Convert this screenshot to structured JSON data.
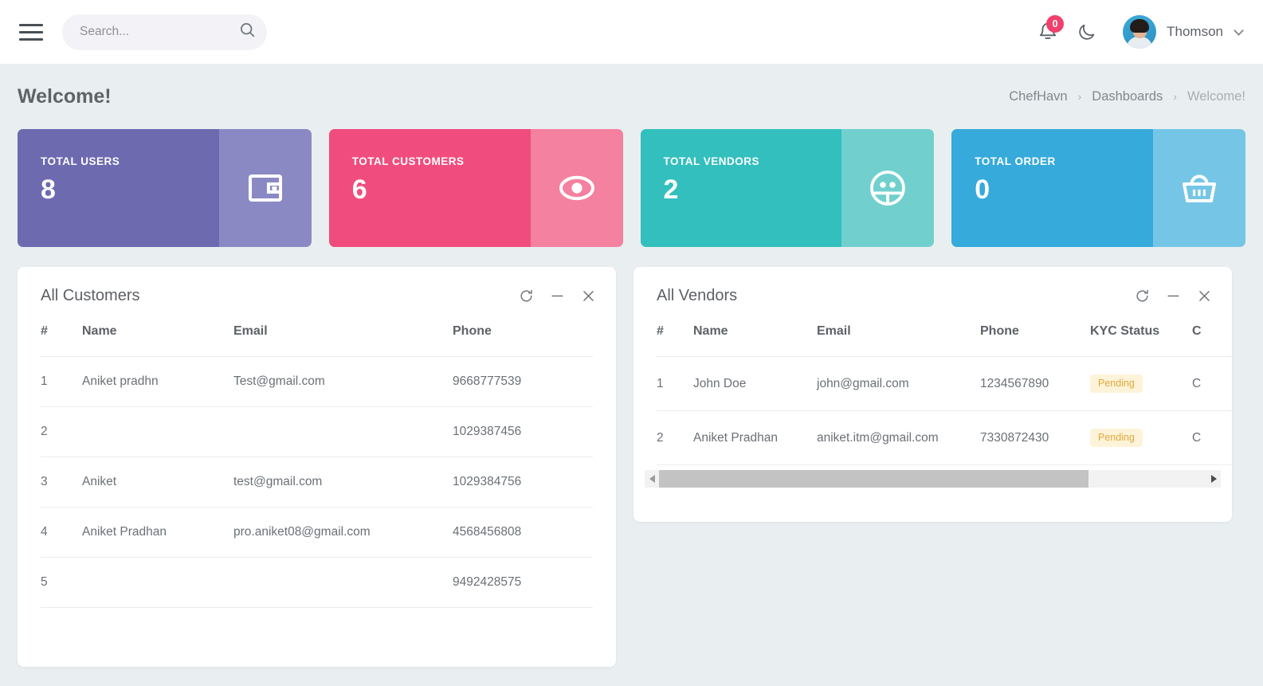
{
  "topbar": {
    "menu_icon": "hamburger-icon",
    "search": {
      "placeholder": "Search...",
      "value": "",
      "icon": "search-icon"
    },
    "notifications": {
      "count": "0",
      "icon": "bell-icon"
    },
    "theme_toggle": {
      "icon": "moon-icon"
    },
    "user": {
      "name": "Thomson",
      "avatar": "user-avatar",
      "chevron": "chevron-down-icon"
    }
  },
  "page": {
    "title": "Welcome!",
    "breadcrumb": [
      {
        "label": "ChefHavn",
        "active": false
      },
      {
        "label": "Dashboards",
        "active": false
      },
      {
        "label": "Welcome!",
        "active": true
      }
    ],
    "breadcrumb_separator": "›"
  },
  "stats": [
    {
      "label": "TOTAL USERS",
      "value": "8",
      "icon": "wallet-icon",
      "color": "#6d6ab0",
      "icon_bg": "#8b89c4"
    },
    {
      "label": "TOTAL CUSTOMERS",
      "value": "6",
      "icon": "eye-icon",
      "color": "#f1traverse",
      "bg": "#f04d7e",
      "icon_bg": "#f4819f"
    },
    {
      "label": "TOTAL VENDORS",
      "value": "2",
      "icon": "people-icon",
      "bg": "#33bfbd",
      "icon_bg": "#71d0ce"
    },
    {
      "label": "TOTAL ORDER",
      "value": "0",
      "icon": "basket-icon",
      "bg": "#36aada",
      "icon_bg": "#75c6e6"
    }
  ],
  "customers_panel": {
    "title": "All Customers",
    "tools": [
      "refresh-icon",
      "minimize-icon",
      "close-icon"
    ],
    "columns": [
      "#",
      "Name",
      "Email",
      "Phone"
    ],
    "rows": [
      {
        "idx": "1",
        "name": "Aniket pradhn",
        "email": "Test@gmail.com",
        "phone": "9668777539"
      },
      {
        "idx": "2",
        "name": "",
        "email": "",
        "phone": "1029387456"
      },
      {
        "idx": "3",
        "name": "Aniket",
        "email": "test@gmail.com",
        "phone": "1029384756"
      },
      {
        "idx": "4",
        "name": "Aniket Pradhan",
        "email": "pro.aniket08@gmail.com",
        "phone": "4568456808"
      },
      {
        "idx": "5",
        "name": "",
        "email": "",
        "phone": "9492428575"
      }
    ]
  },
  "vendors_panel": {
    "title": "All Vendors",
    "tools": [
      "refresh-icon",
      "minimize-icon",
      "close-icon"
    ],
    "columns": [
      "#",
      "Name",
      "Email",
      "Phone",
      "KYC Status",
      "C"
    ],
    "rows": [
      {
        "idx": "1",
        "name": "John Doe",
        "email": "john@gmail.com",
        "phone": "1234567890",
        "kyc": "Pending",
        "extra": "C"
      },
      {
        "idx": "2",
        "name": "Aniket Pradhan",
        "email": "aniket.itm@gmail.com",
        "phone": "7330872430",
        "kyc": "Pending",
        "extra": "C"
      }
    ],
    "scrollbar": {
      "position": "78%"
    }
  }
}
